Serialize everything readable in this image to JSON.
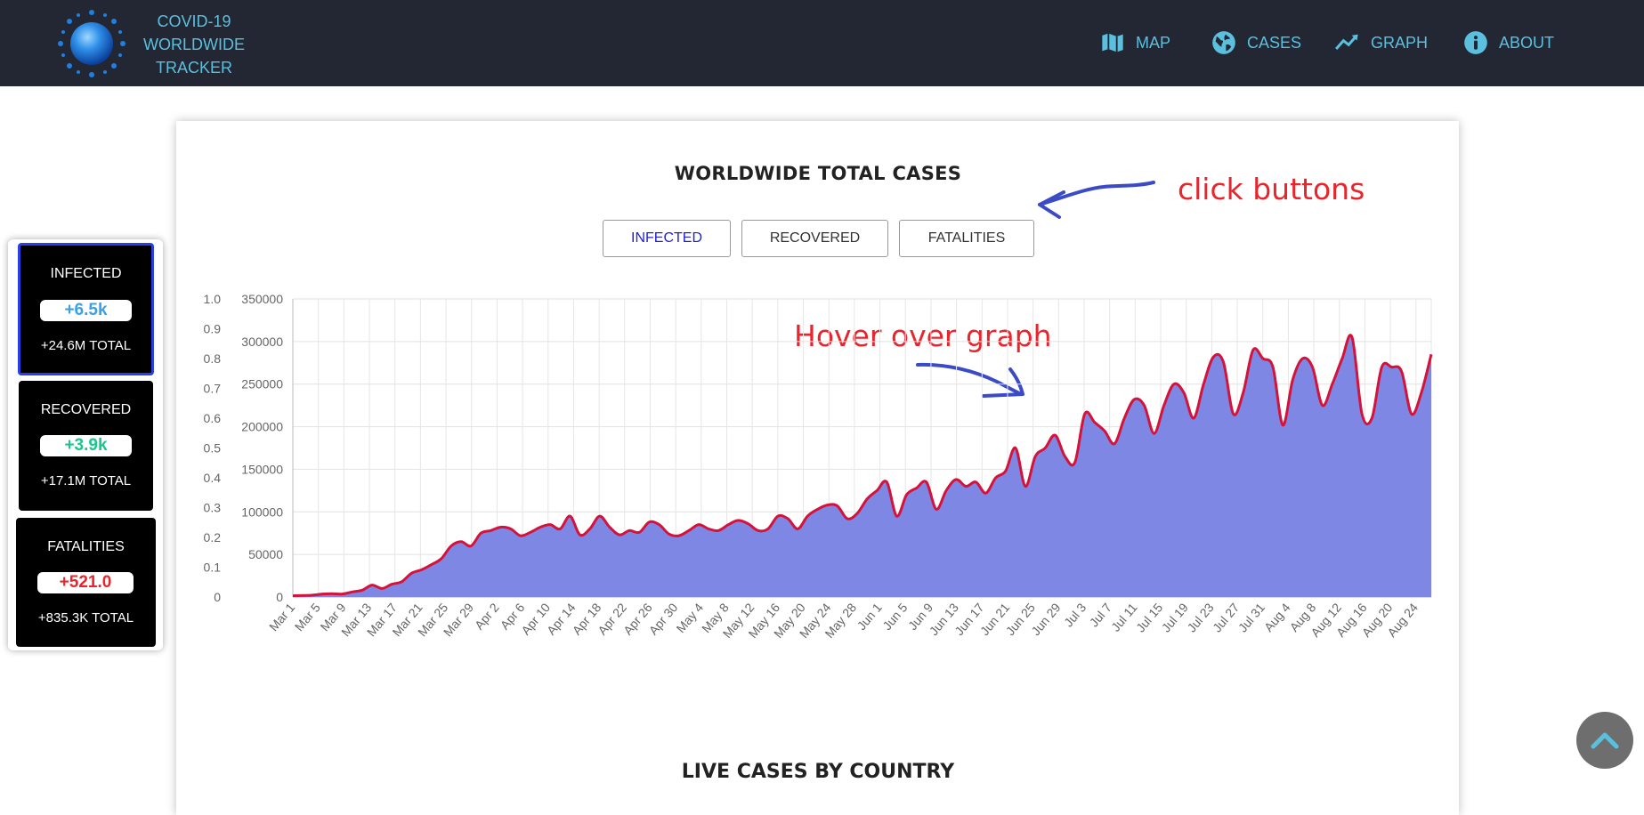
{
  "brand": {
    "line1": "COVID-19",
    "line2": "WORLDWIDE",
    "line3": "TRACKER"
  },
  "nav": [
    {
      "label": "MAP",
      "icon": "map-icon"
    },
    {
      "label": "CASES",
      "icon": "globe-icon"
    },
    {
      "label": "GRAPH",
      "icon": "trend-line-icon"
    },
    {
      "label": "ABOUT",
      "icon": "info-icon"
    }
  ],
  "chart_section": {
    "title": "WORLDWIDE TOTAL CASES",
    "tabs": [
      {
        "label": "INFECTED",
        "active": true
      },
      {
        "label": "RECOVERED",
        "active": false
      },
      {
        "label": "FATALITIES",
        "active": false
      }
    ]
  },
  "annotations": {
    "buttons": "click buttons",
    "graph": "Hover over graph"
  },
  "side_stats": [
    {
      "label": "INFECTED",
      "delta": "+6.5k",
      "total": "+24.6M TOTAL",
      "color": "#3aa0e8",
      "active": true
    },
    {
      "label": "RECOVERED",
      "delta": "+3.9k",
      "total": "+17.1M TOTAL",
      "color": "#19c78d",
      "active": false
    },
    {
      "label": "FATALITIES",
      "delta": "+521.0",
      "total": "+835.3K TOTAL",
      "color": "#e8242c",
      "active": false
    }
  ],
  "next_section": {
    "title": "LIVE CASES BY COUNTRY"
  },
  "colors": {
    "nav_bg": "#222733",
    "accent": "#5bc0de",
    "area_fill": "#7e87e3",
    "line": "#d4123a"
  },
  "chart_data": {
    "type": "area",
    "x_ticks": [
      "Mar 1",
      "Mar 5",
      "Mar 9",
      "Mar 13",
      "Mar 17",
      "Mar 21",
      "Mar 25",
      "Mar 29",
      "Apr 2",
      "Apr 6",
      "Apr 10",
      "Apr 14",
      "Apr 18",
      "Apr 22",
      "Apr 26",
      "Apr 30",
      "May 4",
      "May 8",
      "May 12",
      "May 16",
      "May 20",
      "May 24",
      "May 28",
      "Jun 1",
      "Jun 5",
      "Jun 9",
      "Jun 13",
      "Jun 17",
      "Jun 21",
      "Jun 25",
      "Jun 29",
      "Jul 3",
      "Jul 7",
      "Jul 11",
      "Jul 15",
      "Jul 19",
      "Jul 23",
      "Jul 27",
      "Jul 31",
      "Aug 4",
      "Aug 8",
      "Aug 12",
      "Aug 16",
      "Aug 20",
      "Aug 24"
    ],
    "y_ticks": [
      0,
      50000,
      100000,
      150000,
      200000,
      250000,
      300000,
      350000
    ],
    "y2_ticks": [
      0,
      0.1,
      0.2,
      0.3,
      0.4,
      0.5,
      0.6,
      0.7,
      0.8,
      0.9,
      1.0
    ],
    "ylim": [
      0,
      350000
    ],
    "y2lim": [
      0,
      1.0
    ],
    "grid": true,
    "series": [
      {
        "values": [
          1500,
          1800,
          2200,
          3500,
          4000,
          3500,
          6000,
          8000,
          14000,
          10000,
          15000,
          18000,
          28000,
          32000,
          38000,
          45000,
          60000,
          65000,
          60000,
          75000,
          78000,
          82000,
          80000,
          72000,
          76000,
          82000,
          85000,
          80000,
          95000,
          73000,
          80000,
          95000,
          82000,
          73000,
          78000,
          76000,
          88000,
          85000,
          74000,
          72000,
          78000,
          85000,
          80000,
          78000,
          85000,
          90000,
          86000,
          78000,
          80000,
          95000,
          92000,
          80000,
          95000,
          103000,
          108000,
          107000,
          92000,
          98000,
          115000,
          125000,
          135000,
          95000,
          120000,
          128000,
          135000,
          103000,
          125000,
          138000,
          130000,
          135000,
          122000,
          140000,
          148000,
          175000,
          130000,
          165000,
          175000,
          190000,
          165000,
          158000,
          215000,
          205000,
          195000,
          180000,
          210000,
          232000,
          225000,
          192000,
          225000,
          250000,
          240000,
          210000,
          250000,
          282000,
          276000,
          215000,
          240000,
          290000,
          280000,
          270000,
          202000,
          255000,
          280000,
          270000,
          225000,
          250000,
          280000,
          305000,
          215000,
          210000,
          270000,
          270000,
          265000,
          215000,
          240000,
          285000
        ]
      }
    ]
  }
}
